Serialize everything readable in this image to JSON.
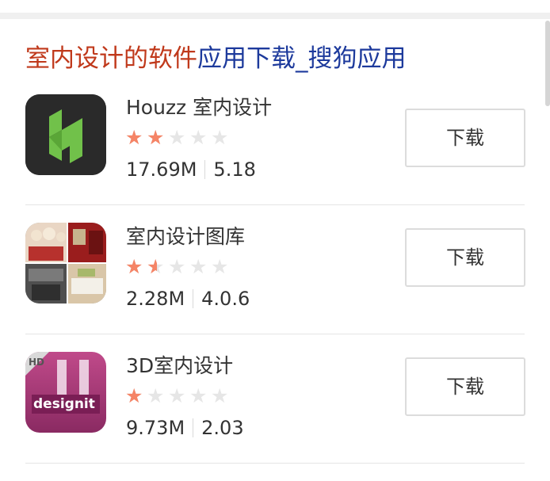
{
  "card": {
    "title_highlight": "室内设计的软件",
    "title_rest": "应用下载_搜狗应用"
  },
  "apps": [
    {
      "name": "Houzz 室内设计",
      "rating": 2,
      "size": "17.69M",
      "version": "5.18",
      "button": "下载",
      "icon": "houzz-logo-icon"
    },
    {
      "name": "室内设计图库",
      "rating": 1.5,
      "size": "2.28M",
      "version": "4.0.6",
      "button": "下载",
      "icon": "interior-photo-collage-icon"
    },
    {
      "name": "3D室内设计",
      "rating": 1,
      "size": "9.73M",
      "version": "2.03",
      "button": "下载",
      "icon": "designit-logo-icon",
      "icon_text": "designit",
      "icon_badge": "HD"
    }
  ],
  "colors": {
    "title_highlight": "#c0391b",
    "title_rest": "#1d3a9c",
    "star_filled": "#f58466",
    "star_empty": "#e6e6e6"
  }
}
